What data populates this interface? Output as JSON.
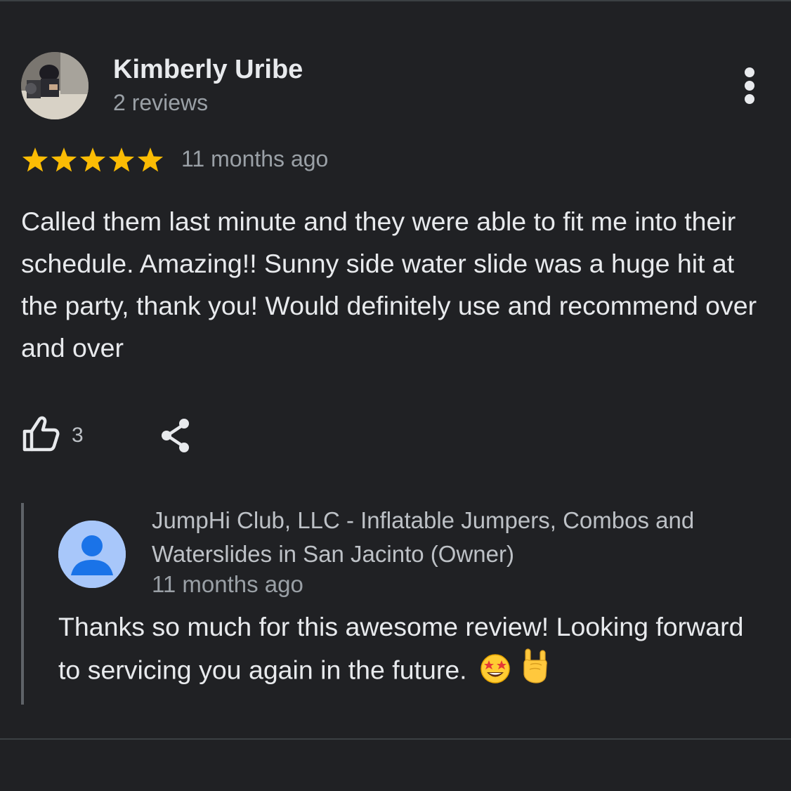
{
  "review": {
    "reviewer_name": "Kimberly Uribe",
    "reviewer_meta": "2 reviews",
    "rating": 5,
    "rating_max": 5,
    "date": "11 months ago",
    "text": "Called them last minute and they were able to fit me into their schedule. Amazing!! Sunny side water slide was a huge hit at the party, thank you! Would definitely use and recommend over and over",
    "like_count": "3",
    "icons": {
      "more": "more-vert-icon",
      "star": "star-icon",
      "like": "thumb-up-icon",
      "share": "share-icon"
    }
  },
  "owner_response": {
    "name": "JumpHi Club, LLC - Inflatable Jumpers, Combos and Waterslides in San Jacinto (Owner)",
    "date": "11 months ago",
    "text": "Thanks so much for this awesome review! Looking forward to servicing you again in the future.",
    "emojis": [
      "star-struck-emoji",
      "rock-on-hand-emoji"
    ]
  },
  "colors": {
    "background": "#202124",
    "star": "#fbbc04",
    "primary_text": "#e8eaed",
    "secondary_text": "#9aa0a6",
    "owner_avatar_bg": "#a8c7fa",
    "owner_avatar_fg": "#1a73e8"
  }
}
